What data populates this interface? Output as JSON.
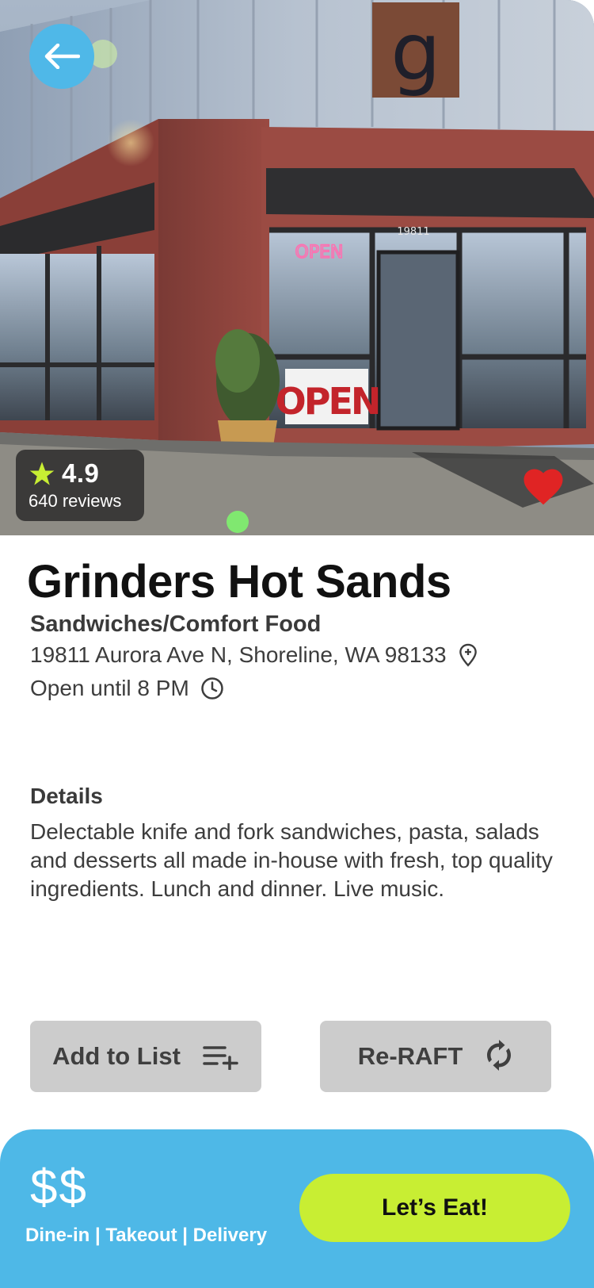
{
  "restaurant": {
    "name": "Grinders Hot Sands",
    "category": "Sandwiches/Comfort Food",
    "address": "19811 Aurora Ave N, Shoreline, WA 98133",
    "hours": "Open until 8 PM",
    "rating": "4.9",
    "reviews": "640 reviews",
    "favorited": true
  },
  "hero": {
    "sign_open": "OPEN",
    "window_open": "OPEN",
    "street_number": "19811",
    "logo_letter": "g"
  },
  "details": {
    "title": "Details",
    "text": "Delectable knife and fork sandwiches, pasta, salads and desserts all made in-house with fresh, top quality ingredients. Lunch and dinner. Live music."
  },
  "actions": {
    "add_to_list": "Add to List",
    "reraft": "Re-RAFT"
  },
  "footer": {
    "price": "$$",
    "services": "Dine-in | Takeout | Delivery",
    "cta": "Let’s Eat!"
  },
  "icons": {
    "back": "arrow-left-icon",
    "star": "star-icon",
    "heart": "heart-icon",
    "location": "map-pin-icon",
    "clock": "clock-icon",
    "playlist_add": "playlist-add-icon",
    "refresh": "refresh-icon"
  },
  "colors": {
    "accent_blue": "#4eb8e7",
    "cta_green": "#c8ee33",
    "star_green": "#c8ee33",
    "heart_red": "#e02424",
    "button_gray": "#cccccc"
  }
}
